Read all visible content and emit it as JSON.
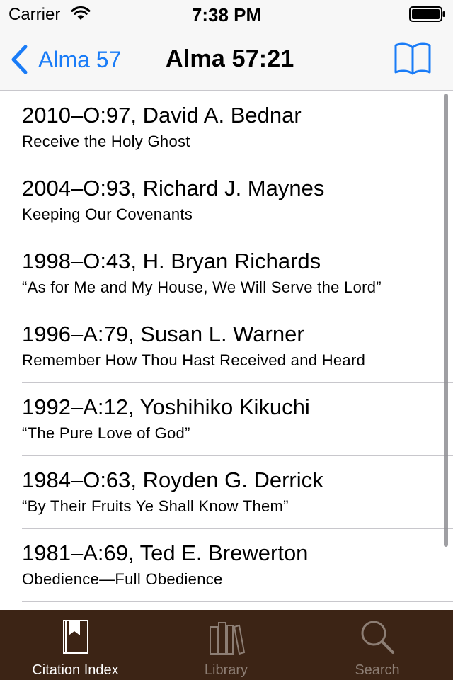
{
  "status_bar": {
    "carrier": "Carrier",
    "time": "7:38 PM"
  },
  "nav": {
    "back_label": "Alma 57",
    "title": "Alma 57:21",
    "accent_color": "#1a7cf7"
  },
  "citations": [
    {
      "title": "2010–O:97, David A. Bednar",
      "subtitle": "Receive the Holy Ghost"
    },
    {
      "title": "2004–O:93, Richard J. Maynes",
      "subtitle": "Keeping Our Covenants"
    },
    {
      "title": "1998–O:43, H. Bryan Richards",
      "subtitle": "“As for Me and My House, We Will Serve the Lord”"
    },
    {
      "title": "1996–A:79, Susan L. Warner",
      "subtitle": "Remember How Thou Hast Received and Heard"
    },
    {
      "title": "1992–A:12, Yoshihiko Kikuchi",
      "subtitle": "“The Pure Love of God”"
    },
    {
      "title": "1984–O:63, Royden G. Derrick",
      "subtitle": "“By Their Fruits Ye Shall Know Them”"
    },
    {
      "title": "1981–A:69, Ted E. Brewerton",
      "subtitle": "Obedience—Full Obedience"
    }
  ],
  "tab_bar": {
    "background_color": "#3c2415",
    "tabs": [
      {
        "label": "Citation Index",
        "icon": "bookmark-book-icon",
        "active": true
      },
      {
        "label": "Library",
        "icon": "books-icon",
        "active": false
      },
      {
        "label": "Search",
        "icon": "magnifier-icon",
        "active": false
      }
    ]
  }
}
